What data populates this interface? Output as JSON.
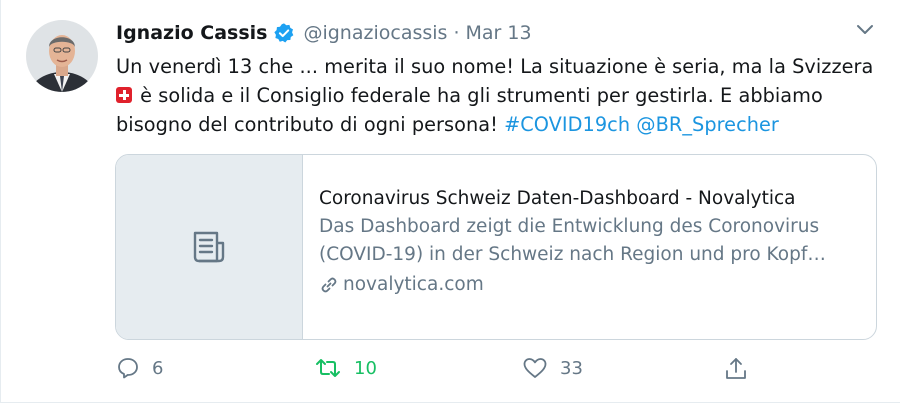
{
  "tweet": {
    "author_name": "Ignazio Cassis",
    "handle": "@ignaziocassis",
    "separator": "·",
    "date": "Mar 13",
    "text_part1": "Un venerdì 13 che ... merita il suo nome! La situazione è seria, ma la Svizzera",
    "text_part2": " è solida e il Consiglio federale ha gli strumenti per gestirla. E abbiamo bisogno del contributo di ogni persona! ",
    "hashtag": "#COVID19ch",
    "mention": "@BR_Sprecher"
  },
  "card": {
    "title": "Coronavirus Schweiz Daten-Dashboard - Novalytica",
    "description": "Das Dashboard zeigt die Entwicklung des Coronovirus (COVID-19) in der Schweiz nach Region und pro Kopf…",
    "domain": "novalytica.com",
    "thumb_icon": "document-icon"
  },
  "actions": {
    "reply_count": "6",
    "retweet_count": "10",
    "like_count": "33"
  },
  "colors": {
    "link": "#1b95e0",
    "muted": "#657786",
    "retweet": "#17bf63",
    "verified": "#1da1f2"
  }
}
